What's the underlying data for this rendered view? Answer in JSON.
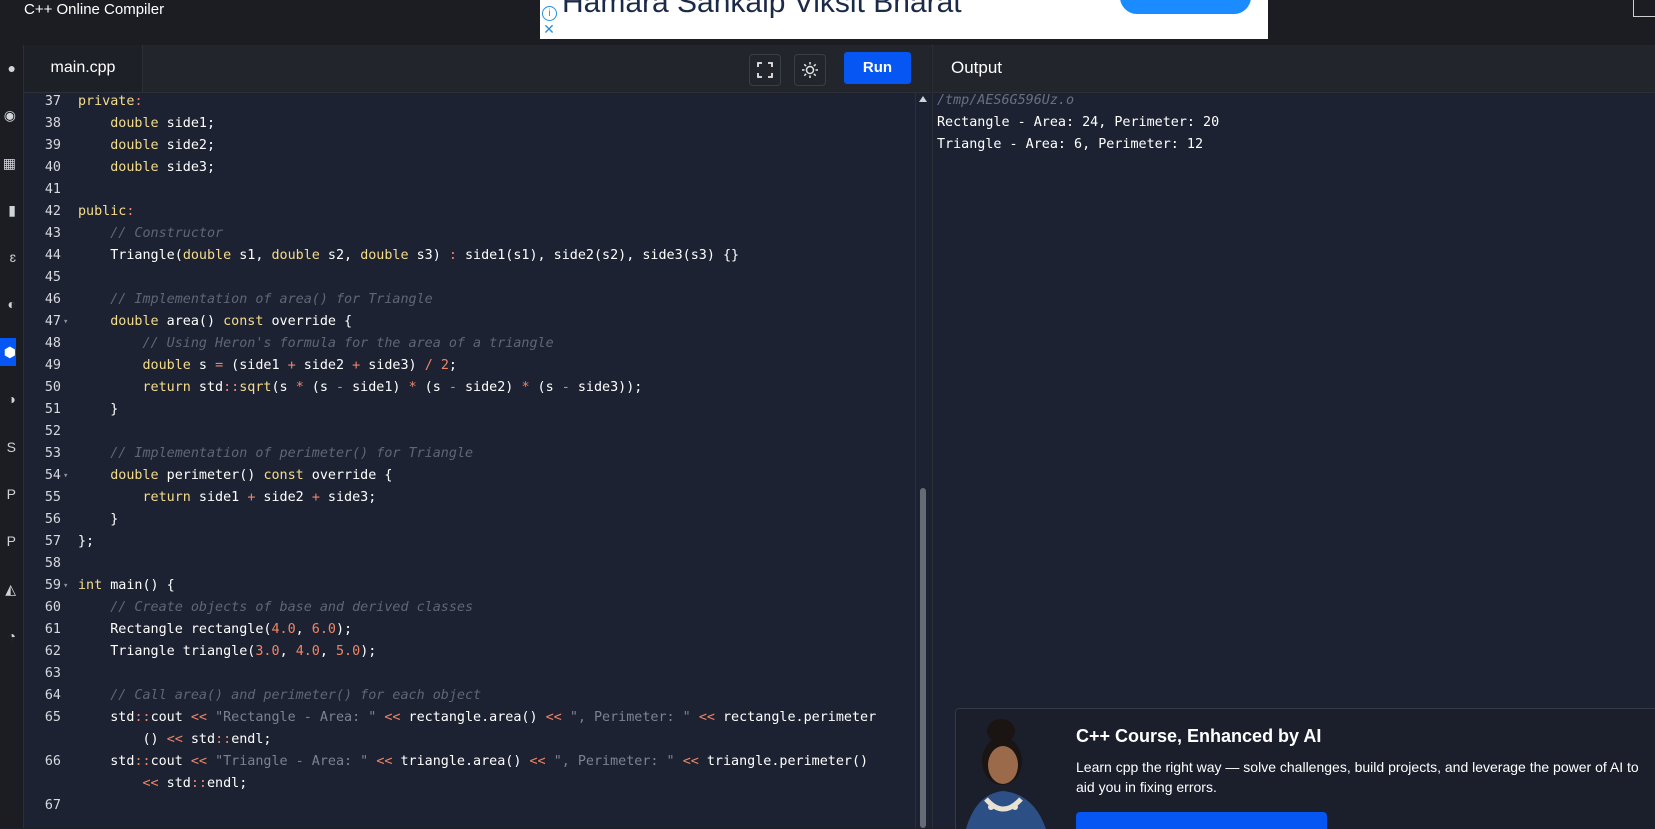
{
  "app": {
    "title": "C++ Online Compiler"
  },
  "ad": {
    "text": "Hamara Sankalp Viksit Bharat",
    "info_glyph": "i",
    "close_glyph": "✕"
  },
  "editor": {
    "tab_label": "main.cpp",
    "fullscreen_icon": "fullscreen-icon",
    "theme_icon": "sun-icon",
    "run_label": "Run",
    "lines": [
      {
        "n": "37",
        "fold": false,
        "tokens": [
          [
            "kw",
            "private"
          ],
          [
            "op",
            ":"
          ]
        ]
      },
      {
        "n": "38",
        "fold": false,
        "tokens": [
          [
            "",
            "    "
          ],
          [
            "kw",
            "double"
          ],
          [
            "",
            " side1;"
          ]
        ]
      },
      {
        "n": "39",
        "fold": false,
        "tokens": [
          [
            "",
            "    "
          ],
          [
            "kw",
            "double"
          ],
          [
            "",
            " side2;"
          ]
        ]
      },
      {
        "n": "40",
        "fold": false,
        "tokens": [
          [
            "",
            "    "
          ],
          [
            "kw",
            "double"
          ],
          [
            "",
            " side3;"
          ]
        ]
      },
      {
        "n": "41",
        "fold": false,
        "tokens": []
      },
      {
        "n": "42",
        "fold": false,
        "tokens": [
          [
            "kw",
            "public"
          ],
          [
            "op",
            ":"
          ]
        ]
      },
      {
        "n": "43",
        "fold": false,
        "tokens": [
          [
            "",
            "    "
          ],
          [
            "cm",
            "// Constructor"
          ]
        ]
      },
      {
        "n": "44",
        "fold": false,
        "tokens": [
          [
            "",
            "    Triangle("
          ],
          [
            "kw",
            "double"
          ],
          [
            "",
            " s1, "
          ],
          [
            "kw",
            "double"
          ],
          [
            "",
            " s2, "
          ],
          [
            "kw",
            "double"
          ],
          [
            "",
            " s3) "
          ],
          [
            "op",
            ":"
          ],
          [
            "",
            " side1(s1), side2(s2), side3(s3) {}"
          ]
        ]
      },
      {
        "n": "45",
        "fold": false,
        "tokens": []
      },
      {
        "n": "46",
        "fold": false,
        "tokens": [
          [
            "",
            "    "
          ],
          [
            "cm",
            "// Implementation of area() for Triangle"
          ]
        ]
      },
      {
        "n": "47",
        "fold": true,
        "tokens": [
          [
            "",
            "    "
          ],
          [
            "kw",
            "double"
          ],
          [
            "",
            " area() "
          ],
          [
            "kw",
            "const"
          ],
          [
            "",
            " override {"
          ]
        ]
      },
      {
        "n": "48",
        "fold": false,
        "tokens": [
          [
            "",
            "        "
          ],
          [
            "cm",
            "// Using Heron's formula for the area of a triangle"
          ]
        ]
      },
      {
        "n": "49",
        "fold": false,
        "tokens": [
          [
            "",
            "        "
          ],
          [
            "kw",
            "double"
          ],
          [
            "",
            " s "
          ],
          [
            "op",
            "="
          ],
          [
            "",
            " (side1 "
          ],
          [
            "op",
            "+"
          ],
          [
            "",
            " side2 "
          ],
          [
            "op",
            "+"
          ],
          [
            "",
            " side3) "
          ],
          [
            "op",
            "/"
          ],
          [
            "",
            " "
          ],
          [
            "num",
            "2"
          ],
          [
            "",
            ";"
          ]
        ]
      },
      {
        "n": "50",
        "fold": false,
        "tokens": [
          [
            "",
            "        "
          ],
          [
            "kw",
            "return"
          ],
          [
            "",
            " std"
          ],
          [
            "op",
            "::"
          ],
          [
            "fn",
            "sqrt"
          ],
          [
            "",
            "(s "
          ],
          [
            "op",
            "*"
          ],
          [
            "",
            " (s "
          ],
          [
            "op",
            "-"
          ],
          [
            "",
            " side1) "
          ],
          [
            "op",
            "*"
          ],
          [
            "",
            " (s "
          ],
          [
            "op",
            "-"
          ],
          [
            "",
            " side2) "
          ],
          [
            "op",
            "*"
          ],
          [
            "",
            " (s "
          ],
          [
            "op",
            "-"
          ],
          [
            "",
            " side3));"
          ]
        ]
      },
      {
        "n": "51",
        "fold": false,
        "tokens": [
          [
            "",
            "    }"
          ]
        ]
      },
      {
        "n": "52",
        "fold": false,
        "tokens": []
      },
      {
        "n": "53",
        "fold": false,
        "tokens": [
          [
            "",
            "    "
          ],
          [
            "cm",
            "// Implementation of perimeter() for Triangle"
          ]
        ]
      },
      {
        "n": "54",
        "fold": true,
        "tokens": [
          [
            "",
            "    "
          ],
          [
            "kw",
            "double"
          ],
          [
            "",
            " perimeter() "
          ],
          [
            "kw",
            "const"
          ],
          [
            "",
            " override {"
          ]
        ]
      },
      {
        "n": "55",
        "fold": false,
        "tokens": [
          [
            "",
            "        "
          ],
          [
            "kw",
            "return"
          ],
          [
            "",
            " side1 "
          ],
          [
            "op",
            "+"
          ],
          [
            "",
            " side2 "
          ],
          [
            "op",
            "+"
          ],
          [
            "",
            " side3;"
          ]
        ]
      },
      {
        "n": "56",
        "fold": false,
        "tokens": [
          [
            "",
            "    }"
          ]
        ]
      },
      {
        "n": "57",
        "fold": false,
        "tokens": [
          [
            "",
            "};"
          ]
        ]
      },
      {
        "n": "58",
        "fold": false,
        "tokens": []
      },
      {
        "n": "59",
        "fold": true,
        "tokens": [
          [
            "kw",
            "int"
          ],
          [
            "",
            " main() {"
          ]
        ]
      },
      {
        "n": "60",
        "fold": false,
        "tokens": [
          [
            "",
            "    "
          ],
          [
            "cm",
            "// Create objects of base and derived classes"
          ]
        ]
      },
      {
        "n": "61",
        "fold": false,
        "tokens": [
          [
            "",
            "    Rectangle rectangle("
          ],
          [
            "num",
            "4.0"
          ],
          [
            "",
            ", "
          ],
          [
            "num",
            "6.0"
          ],
          [
            "",
            ");"
          ]
        ]
      },
      {
        "n": "62",
        "fold": false,
        "tokens": [
          [
            "",
            "    Triangle triangle("
          ],
          [
            "num",
            "3.0"
          ],
          [
            "",
            ", "
          ],
          [
            "num",
            "4.0"
          ],
          [
            "",
            ", "
          ],
          [
            "num",
            "5.0"
          ],
          [
            "",
            ");"
          ]
        ]
      },
      {
        "n": "63",
        "fold": false,
        "tokens": []
      },
      {
        "n": "64",
        "fold": false,
        "tokens": [
          [
            "",
            "    "
          ],
          [
            "cm",
            "// Call area() and perimeter() for each object"
          ]
        ]
      },
      {
        "n": "65",
        "fold": false,
        "tokens": [
          [
            "",
            "    std"
          ],
          [
            "op",
            "::"
          ],
          [
            "",
            "cout "
          ],
          [
            "op",
            "<<"
          ],
          [
            "",
            " "
          ],
          [
            "str",
            "\"Rectangle - Area: \""
          ],
          [
            "",
            " "
          ],
          [
            "op",
            "<<"
          ],
          [
            "",
            " rectangle.area() "
          ],
          [
            "op",
            "<<"
          ],
          [
            "",
            " "
          ],
          [
            "str",
            "\", Perimeter: \""
          ],
          [
            "",
            " "
          ],
          [
            "op",
            "<<"
          ],
          [
            "",
            " rectangle.perimeter"
          ]
        ]
      },
      {
        "n": "",
        "fold": false,
        "tokens": [
          [
            "",
            "        () "
          ],
          [
            "op",
            "<<"
          ],
          [
            "",
            " std"
          ],
          [
            "op",
            "::"
          ],
          [
            "",
            "endl;"
          ]
        ]
      },
      {
        "n": "66",
        "fold": false,
        "tokens": [
          [
            "",
            "    std"
          ],
          [
            "op",
            "::"
          ],
          [
            "",
            "cout "
          ],
          [
            "op",
            "<<"
          ],
          [
            "",
            " "
          ],
          [
            "str",
            "\"Triangle - Area: \""
          ],
          [
            "",
            " "
          ],
          [
            "op",
            "<<"
          ],
          [
            "",
            " triangle.area() "
          ],
          [
            "op",
            "<<"
          ],
          [
            "",
            " "
          ],
          [
            "str",
            "\", Perimeter: \""
          ],
          [
            "",
            " "
          ],
          [
            "op",
            "<<"
          ],
          [
            "",
            " triangle.perimeter()"
          ]
        ]
      },
      {
        "n": "",
        "fold": false,
        "tokens": [
          [
            "",
            "        "
          ],
          [
            "op",
            "<<"
          ],
          [
            "",
            " std"
          ],
          [
            "op",
            "::"
          ],
          [
            "",
            "endl;"
          ]
        ]
      },
      {
        "n": "67",
        "fold": false,
        "tokens": []
      }
    ]
  },
  "output": {
    "title": "Output",
    "path": "/tmp/AES6G596Uz.o",
    "lines": [
      "Rectangle - Area: 24, Perimeter: 20",
      "Triangle - Area: 6, Perimeter: 12"
    ]
  },
  "course": {
    "title": "C++ Course, Enhanced by AI",
    "description": "Learn cpp the right way — solve challenges, build projects, and leverage the power of AI to aid you in fixing errors."
  },
  "sidebar": {
    "icons": [
      {
        "name": "sidebar-icon-1",
        "glyph": "●",
        "active": false
      },
      {
        "name": "sidebar-icon-2",
        "glyph": "◉",
        "active": false
      },
      {
        "name": "sidebar-icon-3",
        "glyph": "▦",
        "active": false
      },
      {
        "name": "sidebar-icon-4",
        "glyph": "▮",
        "active": false
      },
      {
        "name": "sidebar-icon-5",
        "glyph": "ɛ",
        "active": false
      },
      {
        "name": "sidebar-icon-6",
        "glyph": "◐",
        "active": false
      },
      {
        "name": "cpp-language-icon",
        "glyph": "⬢",
        "active": true
      },
      {
        "name": "sidebar-icon-8",
        "glyph": "◑",
        "active": false
      },
      {
        "name": "sidebar-icon-9",
        "glyph": "S",
        "active": false
      },
      {
        "name": "sidebar-icon-10",
        "glyph": "P",
        "active": false
      },
      {
        "name": "sidebar-icon-11",
        "glyph": "P",
        "active": false
      },
      {
        "name": "sidebar-icon-12",
        "glyph": "◭",
        "active": false
      },
      {
        "name": "sidebar-icon-13",
        "glyph": "◔",
        "active": false
      }
    ]
  },
  "colors": {
    "accent": "#0556f3",
    "editor_bg": "#1d2232",
    "keyword": "#f5dd8a",
    "comment": "#5f6675",
    "number": "#f08566"
  }
}
